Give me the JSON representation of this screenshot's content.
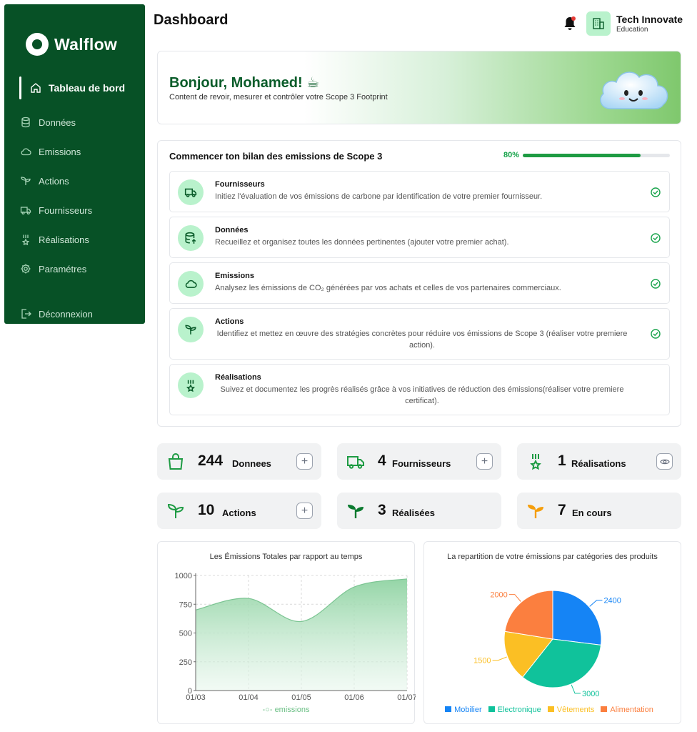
{
  "app": {
    "logo_text": "Walflow"
  },
  "sidebar": {
    "items": [
      {
        "label": "Tableau de bord"
      },
      {
        "label": "Données"
      },
      {
        "label": "Emissions"
      },
      {
        "label": "Actions"
      },
      {
        "label": "Fournisseurs"
      },
      {
        "label": "Réalisations"
      },
      {
        "label": "Paramétres"
      }
    ],
    "logout": "Déconnexion"
  },
  "header": {
    "title": "Dashboard",
    "org_name": "Tech Innovate",
    "org_type": "Education"
  },
  "banner": {
    "greeting": "Bonjour, Mohamed! ☕",
    "subtitle": "Content de revoir, mesurer et contrôler votre Scope 3 Footprint"
  },
  "onboarding": {
    "title": "Commencer ton bilan des emissions de Scope 3",
    "progress_label": "80%",
    "progress": 0.8,
    "steps": [
      {
        "title": "Fournisseurs",
        "desc": "Initiez l'évaluation de vos émissions de carbone par identification de votre premier fournisseur.",
        "done": true
      },
      {
        "title": "Données",
        "desc": "Recueillez et organisez toutes les données pertinentes (ajouter votre premier achat).",
        "done": true
      },
      {
        "title": "Emissions",
        "desc": "Analysez les émissions de CO₂ générées par vos achats et celles de vos partenaires commerciaux.",
        "done": true
      },
      {
        "title": "Actions",
        "desc": "Identifiez et mettez en œuvre des stratégies concrètes pour réduire vos émissions de Scope 3 (réaliser votre premiere action).",
        "done": true
      },
      {
        "title": "Réalisations",
        "desc": "Suivez et documentez les progrès réalisés grâce à vos initiatives de réduction des émissions(réaliser votre premiere certificat).",
        "done": false
      }
    ]
  },
  "stats": [
    {
      "value": "244",
      "label": "Donnees"
    },
    {
      "value": "4",
      "label": "Fournisseurs"
    },
    {
      "value": "1",
      "label": "Réalisations"
    },
    {
      "value": "10",
      "label": "Actions"
    },
    {
      "value": "3",
      "label": "Réalisées"
    },
    {
      "value": "7",
      "label": "En cours"
    }
  ],
  "colors": {
    "sidebar": "#075126",
    "accent": "#1e9b43",
    "accent_light": "#b9f2cc"
  },
  "chart_data": [
    {
      "type": "area",
      "title": "Les Émissions Totales par rapport au temps",
      "x": [
        "01/03",
        "01/04",
        "01/05",
        "01/06",
        "01/07"
      ],
      "series": [
        {
          "name": "emissions",
          "values": [
            700,
            800,
            600,
            900,
            970
          ]
        }
      ],
      "ylim": [
        0,
        1000
      ],
      "yticks": [
        "0",
        "250",
        "500",
        "750",
        "1000"
      ],
      "grid": true,
      "legend": "bottom"
    },
    {
      "type": "pie",
      "title": "La repartition de votre émissions par catégories des produits",
      "categories": [
        "Mobilier",
        "Electronique",
        "Vêtements",
        "Alimentation"
      ],
      "values": [
        2400,
        3000,
        1500,
        2000
      ],
      "labels": [
        "2400",
        "3000",
        "1500",
        "2000"
      ],
      "colors": [
        "#1584f5",
        "#10c29b",
        "#fbbf24",
        "#fb7f3f"
      ],
      "legend": "bottom"
    }
  ]
}
